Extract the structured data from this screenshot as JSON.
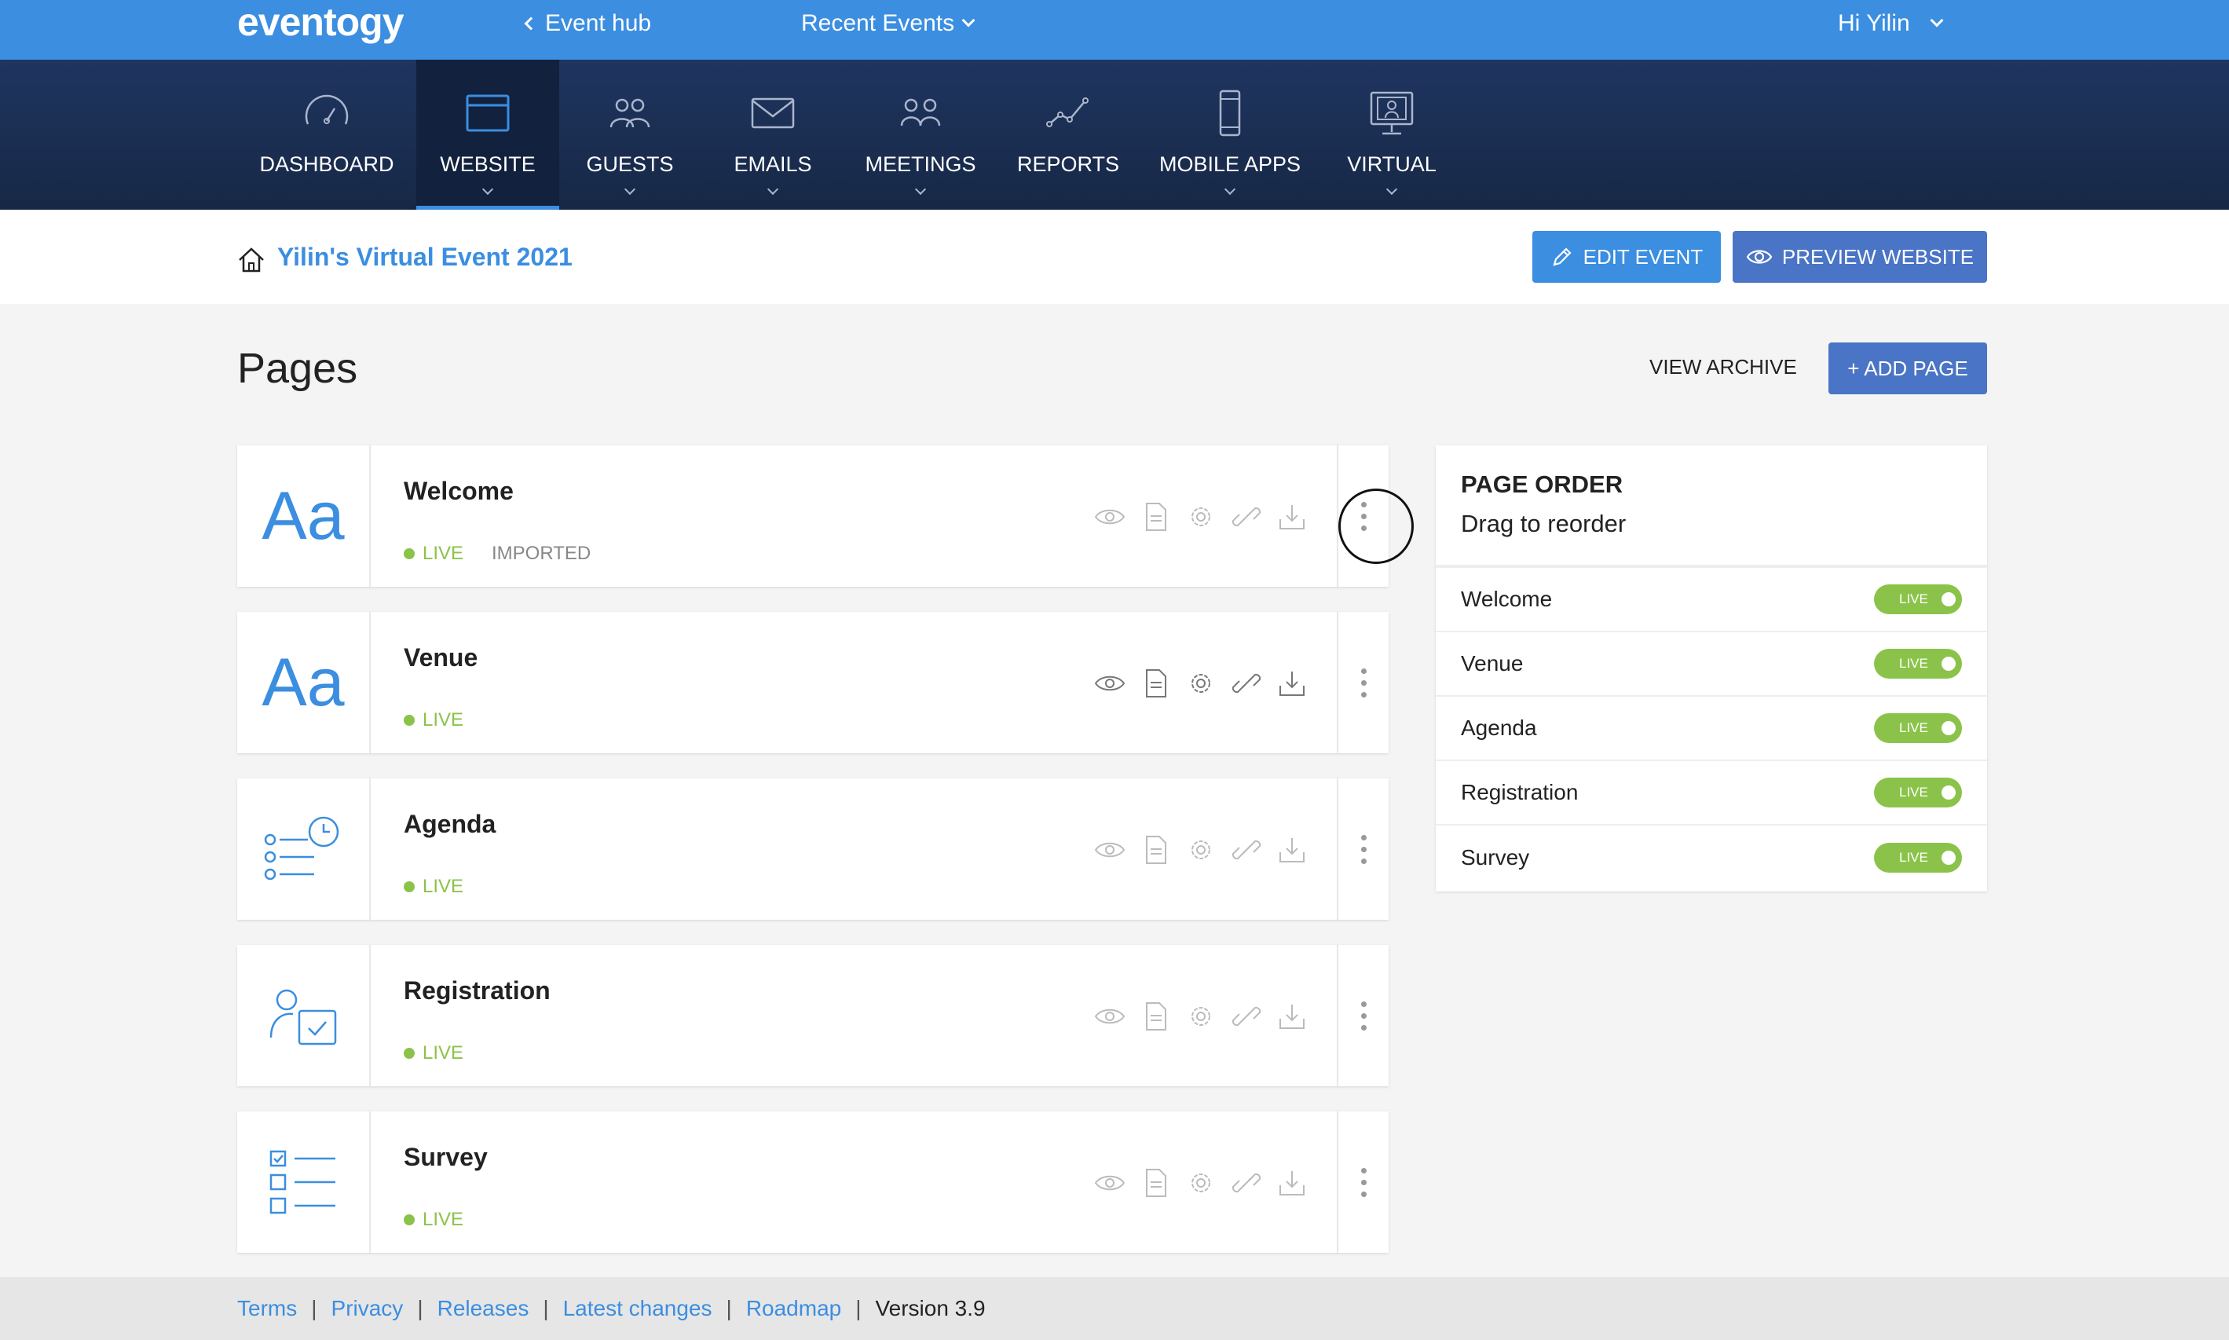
{
  "topbar": {
    "logo": "eventogy",
    "event_hub": "Event hub",
    "recent_events": "Recent Events",
    "greeting": "Hi Yilin"
  },
  "nav": [
    {
      "label": "DASHBOARD",
      "icon": "gauge-icon"
    },
    {
      "label": "WEBSITE",
      "icon": "browser-window-icon"
    },
    {
      "label": "GUESTS",
      "icon": "people-icon"
    },
    {
      "label": "EMAILS",
      "icon": "envelope-icon"
    },
    {
      "label": "MEETINGS",
      "icon": "meeting-people-icon"
    },
    {
      "label": "REPORTS",
      "icon": "trend-line-icon"
    },
    {
      "label": "MOBILE APPS",
      "icon": "phone-icon"
    },
    {
      "label": "VIRTUAL",
      "icon": "monitor-person-icon"
    }
  ],
  "event": {
    "title": "Yilin's Virtual Event 2021",
    "edit_label": "EDIT EVENT",
    "preview_label": "PREVIEW WEBSITE"
  },
  "pages": {
    "heading": "Pages",
    "view_archive": "VIEW ARCHIVE",
    "add_page": "+ ADD PAGE",
    "items": [
      {
        "name": "Welcome",
        "status": "LIVE",
        "tag": "IMPORTED",
        "thumb": "Aa"
      },
      {
        "name": "Venue",
        "status": "LIVE",
        "tag": "",
        "thumb": "Aa"
      },
      {
        "name": "Agenda",
        "status": "LIVE",
        "tag": "",
        "thumb": "agenda-icon"
      },
      {
        "name": "Registration",
        "status": "LIVE",
        "tag": "",
        "thumb": "registration-icon"
      },
      {
        "name": "Survey",
        "status": "LIVE",
        "tag": "",
        "thumb": "survey-checklist-icon"
      }
    ]
  },
  "order": {
    "title": "PAGE ORDER",
    "subtitle": "Drag to reorder",
    "rows": [
      {
        "name": "Welcome",
        "toggle": "LIVE"
      },
      {
        "name": "Venue",
        "toggle": "LIVE"
      },
      {
        "name": "Agenda",
        "toggle": "LIVE"
      },
      {
        "name": "Registration",
        "toggle": "LIVE"
      },
      {
        "name": "Survey",
        "toggle": "LIVE"
      }
    ]
  },
  "footer": {
    "terms": "Terms",
    "privacy": "Privacy",
    "releases": "Releases",
    "latest_changes": "Latest changes",
    "roadmap": "Roadmap",
    "version": "Version 3.9"
  },
  "colors": {
    "brand_blue": "#3b8ee0",
    "nav_dark": "#1f3561",
    "live_green": "#8bc34a",
    "preview_button": "#4a74c5"
  }
}
